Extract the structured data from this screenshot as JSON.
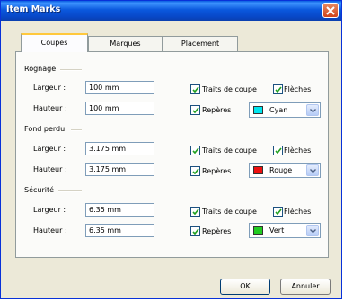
{
  "window": {
    "title": "Item Marks"
  },
  "tabs": [
    {
      "label": "Coupes",
      "active": true
    },
    {
      "label": "Marques",
      "active": false
    },
    {
      "label": "Placement",
      "active": false
    }
  ],
  "sections": [
    {
      "title": "Rognage",
      "width_label": "Largeur :",
      "width_value": "100 mm",
      "height_label": "Hauteur :",
      "height_value": "100 mm",
      "trim_label": "Traits de coupe",
      "trim_checked": true,
      "arrows_label": "Flèches",
      "arrows_checked": true,
      "marks_label": "Repères",
      "marks_checked": true,
      "color_name": "Cyan",
      "color_hex": "#00e5ee"
    },
    {
      "title": "Fond perdu",
      "width_label": "Largeur :",
      "width_value": "3.175 mm",
      "height_label": "Hauteur :",
      "height_value": "3.175 mm",
      "trim_label": "Traits de coupe",
      "trim_checked": true,
      "arrows_label": "Flèches",
      "arrows_checked": true,
      "marks_label": "Repères",
      "marks_checked": true,
      "color_name": "Rouge",
      "color_hex": "#ee1111"
    },
    {
      "title": "Sécurité",
      "width_label": "Largeur :",
      "width_value": "6.35 mm",
      "height_label": "Hauteur :",
      "height_value": "6.35 mm",
      "trim_label": "Traits de coupe",
      "trim_checked": true,
      "arrows_label": "Flèches",
      "arrows_checked": true,
      "marks_label": "Repères",
      "marks_checked": true,
      "color_name": "Vert",
      "color_hex": "#22cc22"
    }
  ],
  "buttons": {
    "ok": "OK",
    "cancel": "Annuler"
  }
}
